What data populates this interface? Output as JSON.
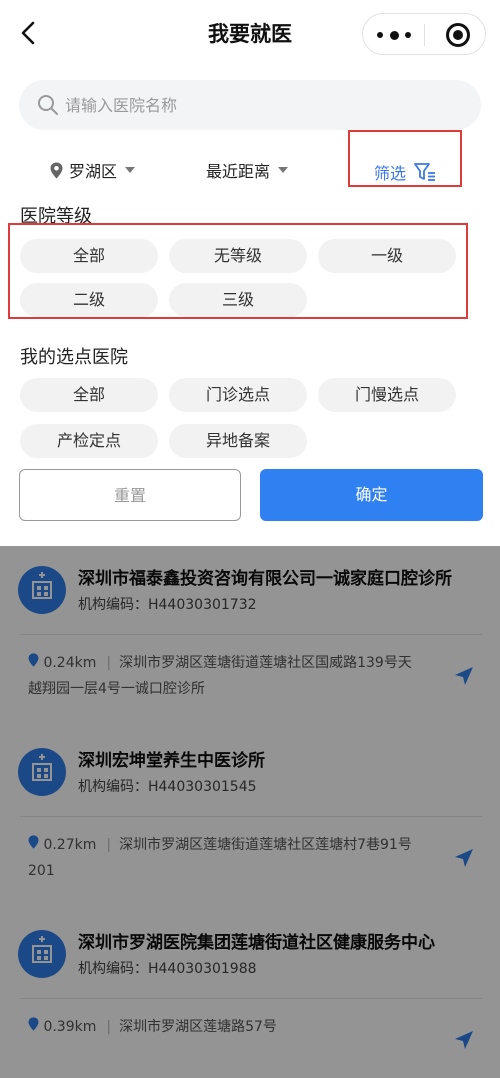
{
  "nav": {
    "title": "我要就医"
  },
  "search": {
    "placeholder": "请输入医院名称"
  },
  "filter_bar": {
    "district": "罗湖区",
    "sort": "最近距离",
    "filter": "筛选"
  },
  "level_section": {
    "title": "医院等级",
    "options": [
      "全部",
      "无等级",
      "一级",
      "二级",
      "三级"
    ]
  },
  "designated_section": {
    "title": "我的选点医院",
    "options": [
      "全部",
      "门诊选点",
      "门慢选点",
      "产检定点",
      "异地备案"
    ]
  },
  "buttons": {
    "reset": "重置",
    "confirm": "确定"
  },
  "hospitals": [
    {
      "name": "深圳市福泰鑫投资咨询有限公司一诚家庭口腔诊所",
      "code": "机构编码：H44030301732",
      "distance": "0.24km",
      "address": "深圳市罗湖区莲塘街道莲塘社区国威路139号天越翔园一层4号一诚口腔诊所"
    },
    {
      "name": "深圳宏坤堂养生中医诊所",
      "code": "机构编码：H44030301545",
      "distance": "0.27km",
      "address": "深圳市罗湖区莲塘街道莲塘社区莲塘村7巷91号201"
    },
    {
      "name": "深圳市罗湖医院集团莲塘街道社区健康服务中心",
      "code": "机构编码：H44030301988",
      "distance": "0.39km",
      "address": "深圳市罗湖区莲塘路57号"
    }
  ],
  "colors": {
    "accent": "#2f80f0",
    "highlight_box": "#e03b3b"
  }
}
